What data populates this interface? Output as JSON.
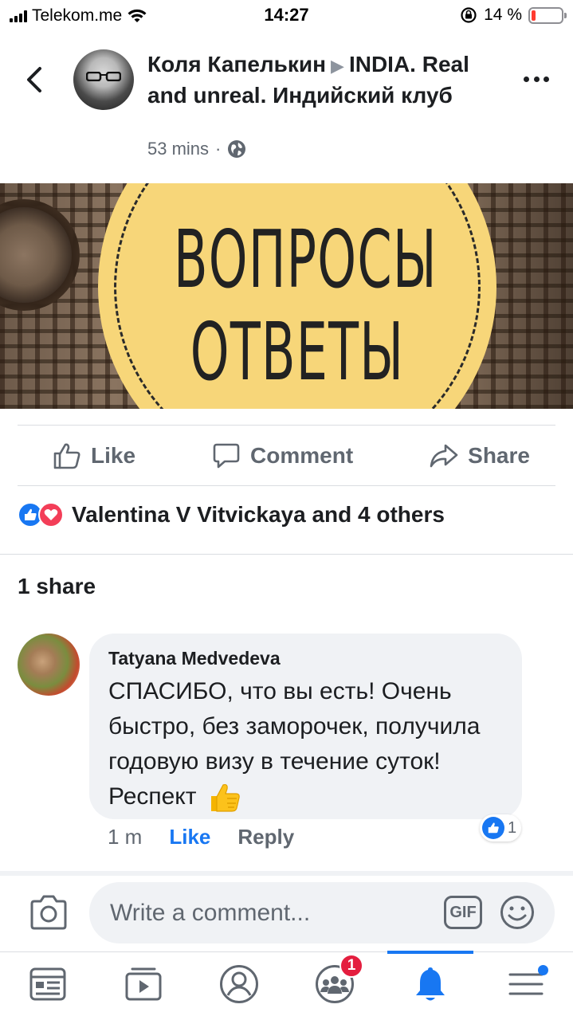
{
  "status_bar": {
    "carrier": "Telekom.me",
    "time": "14:27",
    "battery_percent": "14 %",
    "battery_level": 0.14
  },
  "post": {
    "author": "Коля Капелькин",
    "group": "INDIA. Real and unreal. Индийский клуб",
    "time": "53 mins",
    "privacy_icon": "globe-icon"
  },
  "banner": {
    "line1": "ВОПРОСЫ",
    "line2": "ОТВЕТЫ",
    "circle_color": "#f7d679"
  },
  "actions": {
    "like": "Like",
    "comment": "Comment",
    "share": "Share"
  },
  "reactions": {
    "summary": "Valentina V Vitvickaya and 4 others"
  },
  "shares": "1 share",
  "comment": {
    "author": "Tatyana Medvedeva",
    "text": "СПАСИБО,  что вы есть! Очень быстро, без заморочек, получила годовую визу в течение суток! Респект",
    "time": "1 m",
    "like": "Like",
    "reply": "Reply",
    "like_count": "1"
  },
  "composer": {
    "placeholder": "Write a comment...",
    "gif_label": "GIF"
  },
  "nav": {
    "notifications_badge": "1",
    "accent": "#1877f2"
  }
}
